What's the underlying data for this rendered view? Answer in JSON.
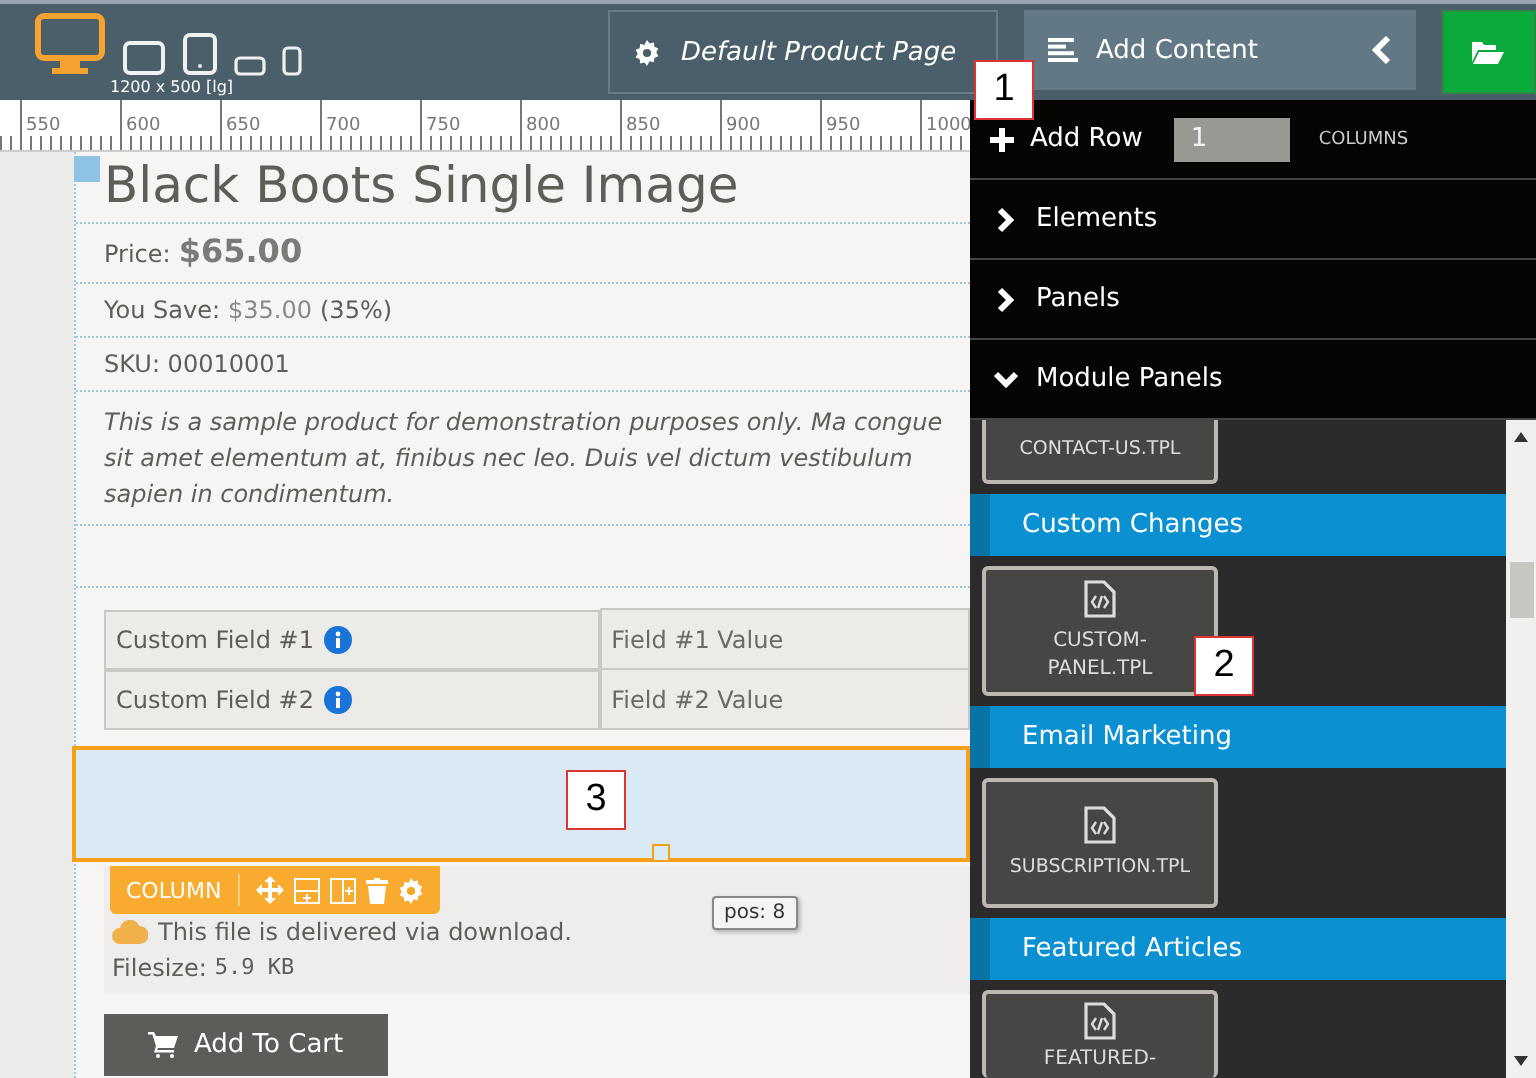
{
  "toolbar": {
    "devices": [
      {
        "kind": "desktop",
        "selected": true
      },
      {
        "kind": "tablet-landscape",
        "selected": false
      },
      {
        "kind": "tablet-portrait",
        "selected": false
      },
      {
        "kind": "phone-landscape",
        "selected": false
      },
      {
        "kind": "phone-portrait",
        "selected": false
      }
    ],
    "resolution": "1200 x 500 [lg]",
    "page_button": "Default Product Page",
    "add_content": "Add Content"
  },
  "ruler": [
    "550",
    "600",
    "650",
    "700",
    "750",
    "800",
    "850",
    "900",
    "950",
    "1000"
  ],
  "product": {
    "title": "Black Boots Single Image",
    "price_label": "Price:",
    "price": "$65.00",
    "save_label": "You Save:",
    "save_amount": "$35.00",
    "save_percent": "(35%)",
    "sku": "SKU: 00010001",
    "description": "This is a sample product for demonstration purposes only. Ma congue sit amet elementum at, finibus nec leo. Duis vel dictum vestibulum sapien in condimentum.",
    "custom_fields": [
      {
        "name": "Custom Field #1",
        "value": "Field #1 Value"
      },
      {
        "name": "Custom Field #2",
        "value": "Field #2 Value"
      }
    ],
    "download_note": "This file is delivered via download.",
    "filesize_label": "Filesize:",
    "filesize": "5.9 KB",
    "cart_button": "Add To Cart"
  },
  "column_toolbar": {
    "label": "COLUMN"
  },
  "tooltip": "pos: 8",
  "panel": {
    "add_row": {
      "label": "Add Row",
      "value": "1",
      "unit": "COLUMNS"
    },
    "sections": [
      {
        "label": "Elements",
        "expanded": false
      },
      {
        "label": "Panels",
        "expanded": false
      },
      {
        "label": "Module Panels",
        "expanded": true
      }
    ],
    "modules": [
      {
        "kind": "tile",
        "label": "CONTACT-US.TPL"
      },
      {
        "kind": "heading",
        "label": "Custom Changes"
      },
      {
        "kind": "tile",
        "label": "CUSTOM-PANEL.TPL"
      },
      {
        "kind": "heading",
        "label": "Email Marketing"
      },
      {
        "kind": "tile",
        "label": "SUBSCRIPTION.TPL"
      },
      {
        "kind": "heading",
        "label": "Featured Articles"
      },
      {
        "kind": "tile",
        "label": "FEATURED-"
      }
    ]
  },
  "callouts": [
    "1",
    "2",
    "3"
  ]
}
